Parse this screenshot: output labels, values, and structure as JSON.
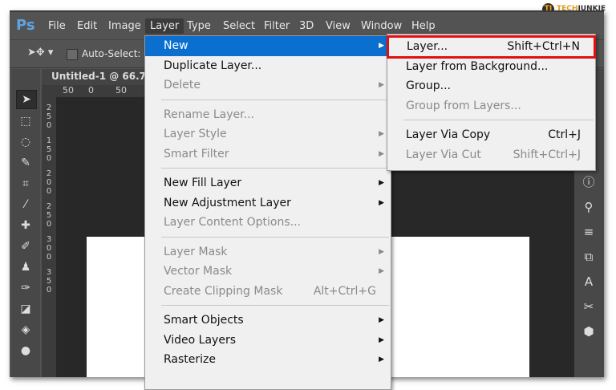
{
  "watermark": {
    "icon": "TJ",
    "text1": "TECH",
    "text2": "JUNKIE"
  },
  "app": {
    "logo": "Ps"
  },
  "menubar": [
    "File",
    "Edit",
    "Image",
    "Layer",
    "Type",
    "Select",
    "Filter",
    "3D",
    "View",
    "Window",
    "Help"
  ],
  "options": {
    "auto_select": "Auto-Select:"
  },
  "document": {
    "tab": "Untitled-1 @ 66.7%",
    "ruler": [
      "50",
      "0",
      "50"
    ],
    "vruler": [
      "2",
      "5",
      "0",
      "1",
      "5",
      "0",
      "2",
      "0",
      "0",
      "2",
      "5",
      "0",
      "3",
      "0",
      "0",
      "3",
      "5",
      "0"
    ]
  },
  "layer_menu": [
    {
      "label": "New",
      "state": "highlighted",
      "submenu": true
    },
    {
      "label": "Duplicate Layer...",
      "state": "enabled"
    },
    {
      "label": "Delete",
      "state": "disabled",
      "submenu": true
    },
    {
      "sep": true
    },
    {
      "label": "Rename Layer...",
      "state": "disabled"
    },
    {
      "label": "Layer Style",
      "state": "disabled",
      "submenu": true
    },
    {
      "label": "Smart Filter",
      "state": "disabled",
      "submenu": true
    },
    {
      "sep": true
    },
    {
      "label": "New Fill Layer",
      "state": "enabled",
      "submenu": true
    },
    {
      "label": "New Adjustment Layer",
      "state": "enabled",
      "submenu": true
    },
    {
      "label": "Layer Content Options...",
      "state": "disabled"
    },
    {
      "sep": true
    },
    {
      "label": "Layer Mask",
      "state": "disabled",
      "submenu": true
    },
    {
      "label": "Vector Mask",
      "state": "disabled",
      "submenu": true
    },
    {
      "label": "Create Clipping Mask",
      "state": "disabled",
      "shortcut": "Alt+Ctrl+G"
    },
    {
      "sep": true
    },
    {
      "label": "Smart Objects",
      "state": "enabled",
      "submenu": true
    },
    {
      "label": "Video Layers",
      "state": "enabled",
      "submenu": true
    },
    {
      "label": "Rasterize",
      "state": "enabled",
      "submenu": true
    }
  ],
  "new_submenu": [
    {
      "label": "Layer...",
      "shortcut": "Shift+Ctrl+N",
      "state": "enabled",
      "boxed": true
    },
    {
      "label": "Layer from Background...",
      "state": "enabled"
    },
    {
      "label": "Group...",
      "state": "enabled"
    },
    {
      "label": "Group from Layers...",
      "state": "disabled"
    },
    {
      "sep": true
    },
    {
      "label": "Layer Via Copy",
      "shortcut": "Ctrl+J",
      "state": "enabled"
    },
    {
      "label": "Layer Via Cut",
      "shortcut": "Shift+Ctrl+J",
      "state": "disabled"
    }
  ],
  "colors": {
    "highlight": "#0a6fcf",
    "callout": "#e01010"
  }
}
